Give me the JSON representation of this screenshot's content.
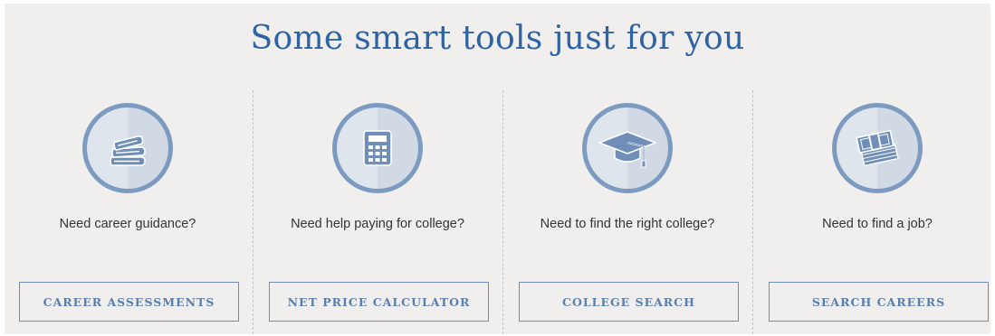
{
  "header": {
    "title": "Some smart tools just for you"
  },
  "colors": {
    "title": "#2f64a4",
    "icon_ring": "#7d9bc0",
    "icon_fill": "#6f8fb8",
    "button_border": "#6e8db6",
    "button_text": "#5a7fae",
    "background": "#f0efee"
  },
  "tools": [
    {
      "icon": "books-icon",
      "prompt": "Need career guidance?",
      "button_label": "CAREER ASSESSMENTS"
    },
    {
      "icon": "calculator-icon",
      "prompt": "Need help paying for college?",
      "button_label": "NET PRICE CALCULATOR"
    },
    {
      "icon": "graduation-cap-icon",
      "prompt": "Need to find the right college?",
      "button_label": "COLLEGE SEARCH"
    },
    {
      "icon": "money-stack-icon",
      "prompt": "Need to find a job?",
      "button_label": "SEARCH CAREERS"
    }
  ]
}
